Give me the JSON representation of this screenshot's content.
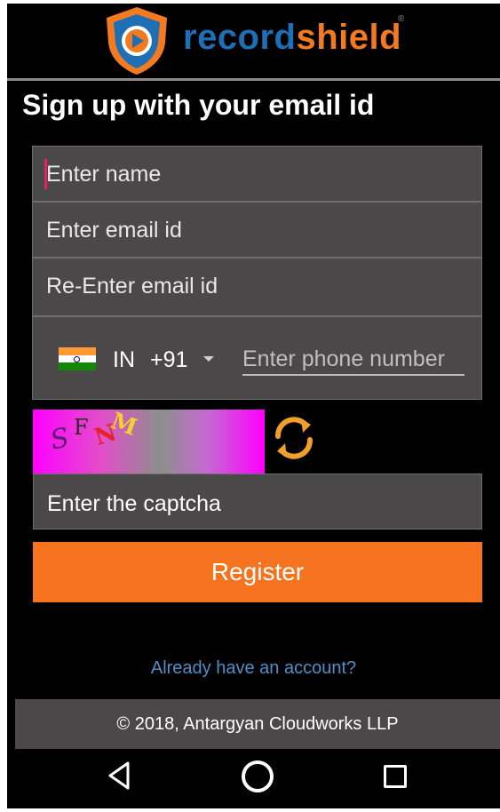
{
  "app": {
    "brand_record": "record",
    "brand_shield": "shield",
    "brand_registered": "®",
    "brand_colors": {
      "record": "#1f6fb6",
      "shield": "#f47a1f",
      "accent": "#f7731f"
    }
  },
  "page": {
    "heading": "Sign up with your email id"
  },
  "form": {
    "name_placeholder": "Enter name",
    "email_placeholder": "Enter email id",
    "reemail_placeholder": "Re-Enter email id",
    "phone": {
      "country_code": "IN",
      "dial_code": "+91",
      "placeholder": "Enter phone number",
      "flag_icon": "india-flag-icon"
    },
    "captcha": {
      "chars": [
        "S",
        "F",
        "N",
        "M"
      ],
      "refresh_icon": "refresh-icon"
    },
    "captcha_placeholder": "Enter the captcha",
    "register_label": "Register",
    "signin_link": "Already have an account?"
  },
  "footer": {
    "copyright": "© 2018, Antargyan Cloudworks LLP"
  },
  "navbar": {
    "icons": [
      "back-icon",
      "home-icon",
      "recent-apps-icon"
    ]
  }
}
